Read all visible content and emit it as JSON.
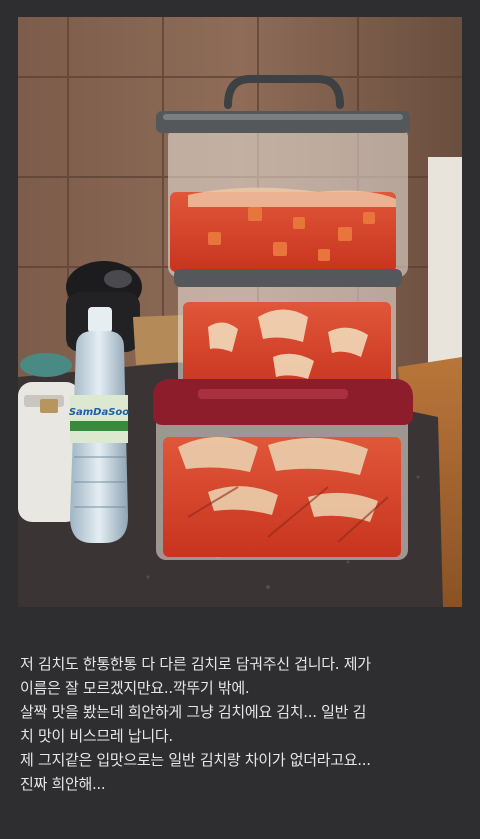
{
  "photo": {
    "bottle_label": "SamDaSoo"
  },
  "caption": {
    "lines": [
      "저 김치도 한통한통 다 다른 김치로 담궈주신 겁니다. 제가",
      "이름은 잘 모르겠지만요..깍뚜기 밖에.",
      "살짝 맛을 봤는데 희안하게 그냥 김치에요 김치... 일반 김",
      "치 맛이 비스므레 납니다.",
      "제 그지같은 입맛으로는 일반 김치랑 차이가 없더라고요...",
      "진짜 희안해..."
    ]
  },
  "colors": {
    "background": "#2e2e30",
    "text": "#e6e6e6",
    "kimchi_red": "#d8432a",
    "lid_red": "#8e1d2c",
    "lid_gray": "#55585a"
  }
}
